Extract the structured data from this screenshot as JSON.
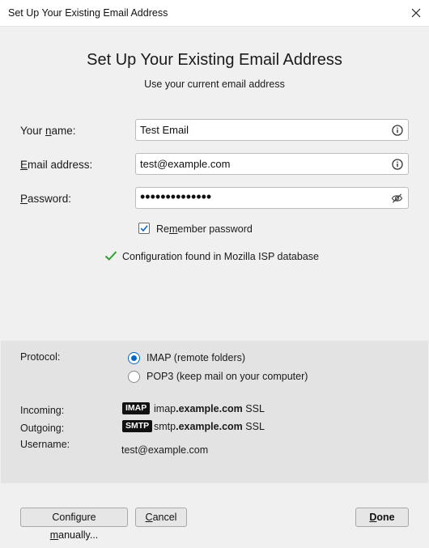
{
  "window": {
    "title": "Set Up Your Existing Email Address"
  },
  "header": {
    "title": "Set Up Your Existing Email Address",
    "subtitle": "Use your current email address"
  },
  "form": {
    "name": {
      "label_pre": "Your ",
      "label_u": "n",
      "label_post": "ame:",
      "value": "Test Email",
      "icon": "info-icon"
    },
    "email": {
      "label_pre": "",
      "label_u": "E",
      "label_post": "mail address:",
      "value": "test@example.com",
      "icon": "info-icon"
    },
    "password": {
      "label_pre": "",
      "label_u": "P",
      "label_post": "assword:",
      "value": "••••••••••••••",
      "icon": "eye-slash-icon"
    },
    "remember": {
      "label_pre": "Re",
      "label_u": "m",
      "label_post": "ember password",
      "checked": true
    }
  },
  "status": {
    "text": "Configuration found in Mozilla ISP database",
    "icon": "checkmark-icon",
    "color": "#2e9e2e"
  },
  "server": {
    "protocol_label": "Protocol:",
    "protocols": [
      {
        "label": "IMAP (remote folders)",
        "selected": true
      },
      {
        "label": "POP3 (keep mail on your computer)",
        "selected": false
      }
    ],
    "incoming_label": "Incoming:",
    "incoming_badge": "IMAP",
    "incoming_host_prefix": "imap",
    "incoming_host_domain": ".example.com",
    "incoming_security": "SSL",
    "outgoing_label": "Outgoing:",
    "outgoing_badge": "SMTP",
    "outgoing_host_prefix": "smtp",
    "outgoing_host_domain": ".example.com",
    "outgoing_security": "SSL",
    "username_label": "Username:",
    "username": "test@example.com"
  },
  "buttons": {
    "configure": {
      "pre": "Configure ",
      "u": "m",
      "post": "anually..."
    },
    "cancel": {
      "pre": "",
      "u": "C",
      "post": "ancel"
    },
    "done": {
      "pre": "",
      "u": "D",
      "post": "one"
    }
  },
  "colors": {
    "accent": "#0a66c2",
    "success": "#2e9e2e"
  }
}
